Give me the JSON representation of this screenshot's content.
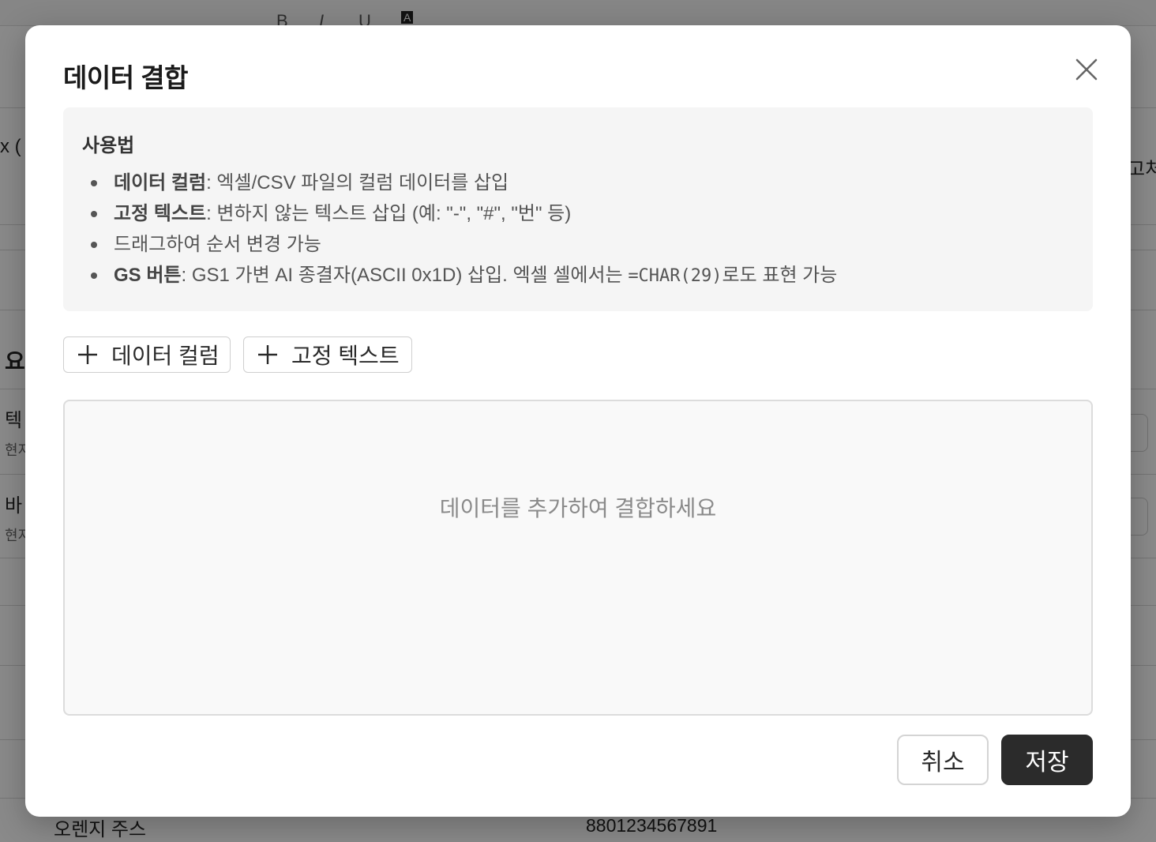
{
  "background": {
    "toolbar_format_glyphs": [
      "B",
      "I",
      "U",
      "A"
    ],
    "partial_texts": [
      "x (",
      "요",
      "텍",
      "현지",
      "바",
      "현지",
      "고처"
    ],
    "bottom_row": {
      "name": "오렌지 주스",
      "barcode": "8801234567891"
    }
  },
  "modal": {
    "title": "데이터 결합",
    "close_icon": "close-icon",
    "help": {
      "title": "사용법",
      "items": [
        {
          "term": "데이터 컬럼",
          "text": ": 엑셀/CSV 파일의 컬럼 데이터를 삽입"
        },
        {
          "term": "고정 텍스트",
          "text": ": 변하지 않는 텍스트 삽입 (예: \"-\", \"#\", \"번\" 등)"
        },
        {
          "term": "",
          "text": "드래그하여 순서 변경 가능"
        },
        {
          "term": "GS 버튼",
          "text": ": GS1 가변 AI 종결자(ASCII 0x1D) 삽입. 엑셀 셀에서는 ",
          "code": "=CHAR(29)",
          "after": "로도 표현 가능"
        }
      ]
    },
    "add_buttons": {
      "data_column": "데이터 컬럼",
      "fixed_text": "고정 텍스트",
      "icon": "plus-icon"
    },
    "drop_zone": {
      "empty_message": "데이터를 추가하여 결합하세요"
    },
    "footer": {
      "cancel": "취소",
      "save": "저장"
    }
  },
  "colors": {
    "primary_button": "#2b2b2b",
    "help_background": "#f5f5f5",
    "drop_zone_background": "#f9f9f9",
    "overlay": "rgba(0,0,0,0.46)"
  }
}
